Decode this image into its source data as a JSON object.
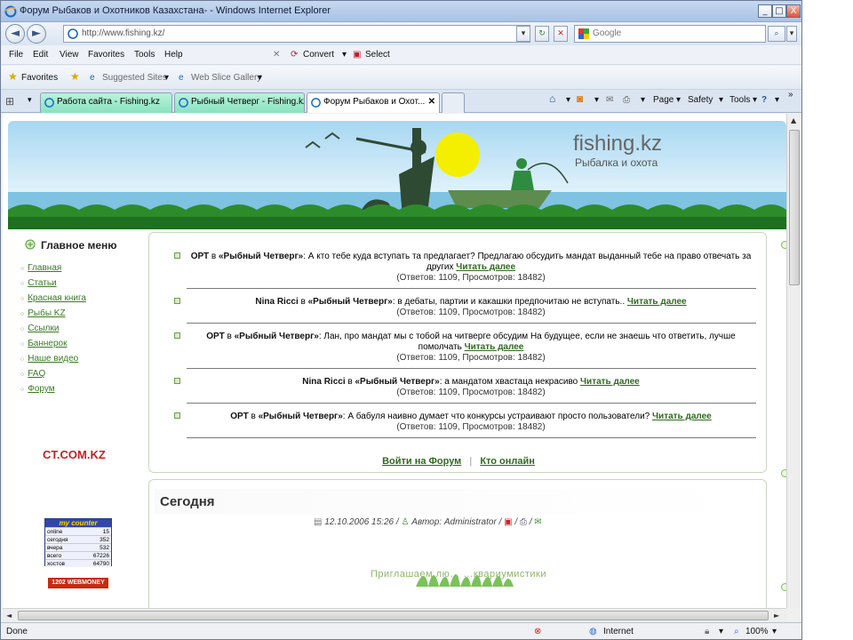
{
  "window": {
    "title": "Форум Рыбаков и Охотников Казахстана- - Windows Internet Explorer",
    "minimize": "_",
    "maximize": "□",
    "close": "X"
  },
  "address": {
    "back": "◄",
    "forward": "►",
    "url": "http://www.fishing.kz/",
    "search_placeholder": "Google"
  },
  "menu": {
    "items": [
      "File",
      "Edit",
      "View",
      "Favorites",
      "Tools",
      "Help"
    ],
    "convert": "Convert",
    "select": "Select"
  },
  "favorites_bar": {
    "favorites": "Favorites",
    "suggested": "Suggested Sites",
    "webslice": "Web Slice Gallery"
  },
  "tabs": [
    {
      "label": "Работа сайта - Fishing.kz"
    },
    {
      "label": "Рыбный Четверг - Fishing.kz"
    },
    {
      "label": "Форум Рыбаков и Охот..."
    }
  ],
  "command_bar": {
    "page": "Page",
    "safety": "Safety",
    "tools": "Tools"
  },
  "banner": {
    "logo": "fishing.kz",
    "tagline": "Рыбалка и охота"
  },
  "sidebar": {
    "title": "Главное меню",
    "items": [
      {
        "label": "Главная"
      },
      {
        "label": "Статьи"
      },
      {
        "label": "Красная книга"
      },
      {
        "label": "Рыбы KZ"
      },
      {
        "label": "Ссылки"
      },
      {
        "label": "Баннерок"
      },
      {
        "label": "Наше видео"
      },
      {
        "label": "FAQ"
      },
      {
        "label": "Форум"
      }
    ],
    "ad": "CT.COM.KZ",
    "counter": {
      "header": "my counter",
      "rows": [
        {
          "label": "online",
          "value": "15"
        },
        {
          "label": "сегодня",
          "value": "352"
        },
        {
          "label": "вчера",
          "value": "532"
        },
        {
          "label": "всего",
          "value": "67226"
        },
        {
          "label": "хостов",
          "value": "64790"
        }
      ]
    },
    "webmoney": "1202 WEBMONEY"
  },
  "forum": {
    "posts": [
      {
        "author": "ОРТ",
        "in": "в",
        "thread": "«Рыбный Четверг»",
        "text": ": А кто тебе куда вступать та предлагает? Предлагаю обсудить мандат выданный тебе на право отвечать за других",
        "readmore": "Читать далее",
        "stats": "(Ответов: 1109, Просмотров: 18482)"
      },
      {
        "author": "Nina Ricci",
        "in": "в",
        "thread": "«Рыбный Четверг»",
        "text": ": в дебаты, партии и какашки предпочитаю не вступать..",
        "readmore": "Читать далее",
        "stats": "(Ответов: 1109, Просмотров: 18482)"
      },
      {
        "author": "ОРТ",
        "in": "в",
        "thread": "«Рыбный Четверг»",
        "text": ": Лан, про мандат мы с тобой на читверге обсудим На будущее, если не знаешь что ответить, лучше помолчать",
        "readmore": "Читать далее",
        "stats": "(Ответов: 1109, Просмотров: 18482)"
      },
      {
        "author": "Nina Ricci",
        "in": "в",
        "thread": "«Рыбный Четверг»",
        "text": ": а мандатом хвастаца некрасиво",
        "readmore": "Читать далее",
        "stats": "(Ответов: 1109, Просмотров: 18482)"
      },
      {
        "author": "ОРТ",
        "in": "в",
        "thread": "«Рыбный Четверг»",
        "text": ": А бабуля наивно думает что конкурсы устраивают просто пользователи?",
        "readmore": "Читать далее",
        "stats": "(Ответов: 1109, Просмотров: 18482)"
      }
    ],
    "login": "Войти на Форум",
    "separator": "|",
    "online": "Кто онлайн"
  },
  "today": {
    "title": "Сегодня",
    "date": "12.10.2006 15:26",
    "author": "Автор: Administrator",
    "invite": "Приглашаем лю… …квариумистики"
  },
  "status": {
    "left": "Done",
    "zone": "Internet",
    "zoom": "100%"
  },
  "colors": {
    "link_green": "#2f6a1e",
    "tab_green": "#89e2c0"
  }
}
